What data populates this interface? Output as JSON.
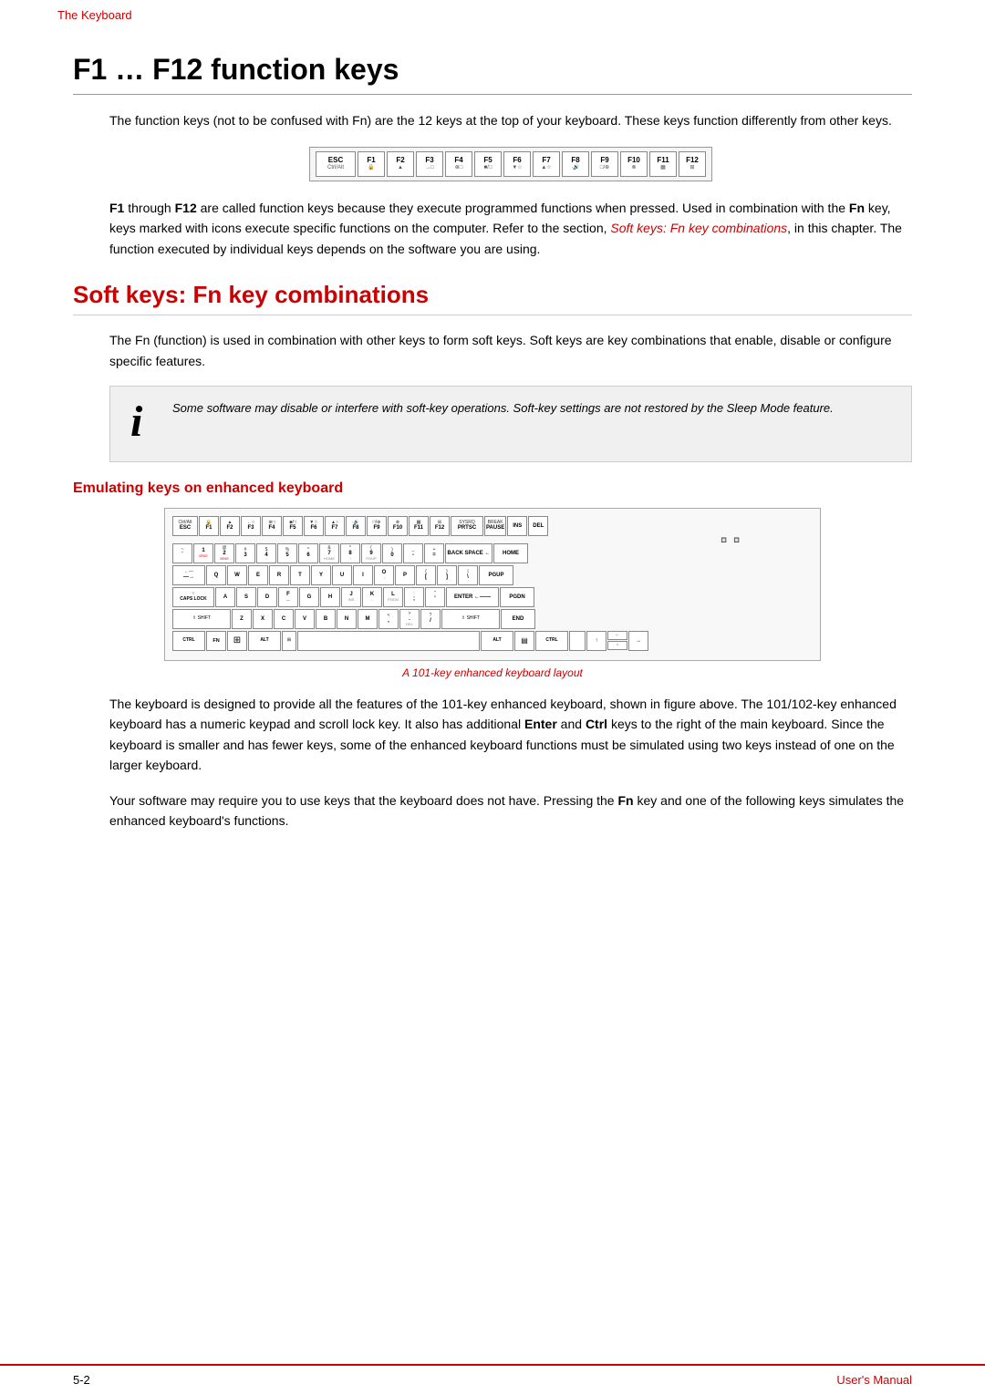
{
  "topbar": {
    "breadcrumb": "The Keyboard"
  },
  "main_heading": "F1 … F12 function keys",
  "intro_paragraph": "The function keys (not to be confused with Fn) are the 12 keys at the top of your keyboard. These keys function differently from other keys.",
  "fn_bold": "Fn",
  "body_paragraph1_before": "F1",
  "body_paragraph1_through": " through ",
  "body_paragraph1_f12": "F12",
  "body_paragraph1_text": " are called function keys because they execute programmed functions when pressed. Used in combination with the ",
  "body_paragraph1_fn": "Fn",
  "body_paragraph1_rest": " key, keys marked with icons execute specific functions on the computer. Refer to the section, ",
  "body_paragraph1_link": "Soft keys: Fn key combinations",
  "body_paragraph1_end": ", in this chapter. The function executed by individual keys depends on the software you are using.",
  "section2_heading": "Soft keys: Fn key combinations",
  "section2_paragraph": "The Fn (function) is used in combination with other keys to form soft keys. Soft keys are key combinations that enable, disable or configure specific features.",
  "info_icon": "i",
  "info_text": "Some software may disable or interfere with soft-key operations. Soft-key settings are not restored by the Sleep Mode feature.",
  "sub_heading": "Emulating keys on enhanced keyboard",
  "kb_caption": "A 101-key enhanced keyboard layout",
  "body_paragraph2": "The keyboard is designed to provide all the features of the 101-key enhanced keyboard, shown in figure above. The 101/102-key enhanced keyboard has a numeric keypad and scroll lock key. It also has additional ",
  "body_paragraph2_enter": "Enter",
  "body_paragraph2_and": " and ",
  "body_paragraph2_ctrl": "Ctrl",
  "body_paragraph2_rest": " keys to the right of the main keyboard. Since the keyboard is smaller and has fewer keys, some of the enhanced keyboard functions must be simulated using two keys instead of one on the larger keyboard.",
  "body_paragraph3": "Your software may require you to use keys that the keyboard does not have. Pressing the ",
  "body_paragraph3_fn": "Fn",
  "body_paragraph3_rest": " key and one of the following keys simulates the enhanced keyboard's functions.",
  "footer": {
    "page": "5-2",
    "title": "User's Manual"
  },
  "function_keys": [
    {
      "label": "ESC",
      "sub": "Ctrl/Alt"
    },
    {
      "label": "F1",
      "sub": "🔒"
    },
    {
      "label": "F2",
      "sub": ""
    },
    {
      "label": "F3",
      "sub": "→□"
    },
    {
      "label": "F4",
      "sub": "⊕□"
    },
    {
      "label": "F5",
      "sub": "■/□"
    },
    {
      "label": "F6",
      "sub": "▼☆"
    },
    {
      "label": "F7",
      "sub": "▲☆"
    },
    {
      "label": "F8",
      "sub": "• 🔊"
    },
    {
      "label": "F9",
      "sub": "□/⊕"
    },
    {
      "label": "F10",
      "sub": "⊗"
    },
    {
      "label": "F11",
      "sub": "▦"
    },
    {
      "label": "F12",
      "sub": "⊞"
    }
  ]
}
